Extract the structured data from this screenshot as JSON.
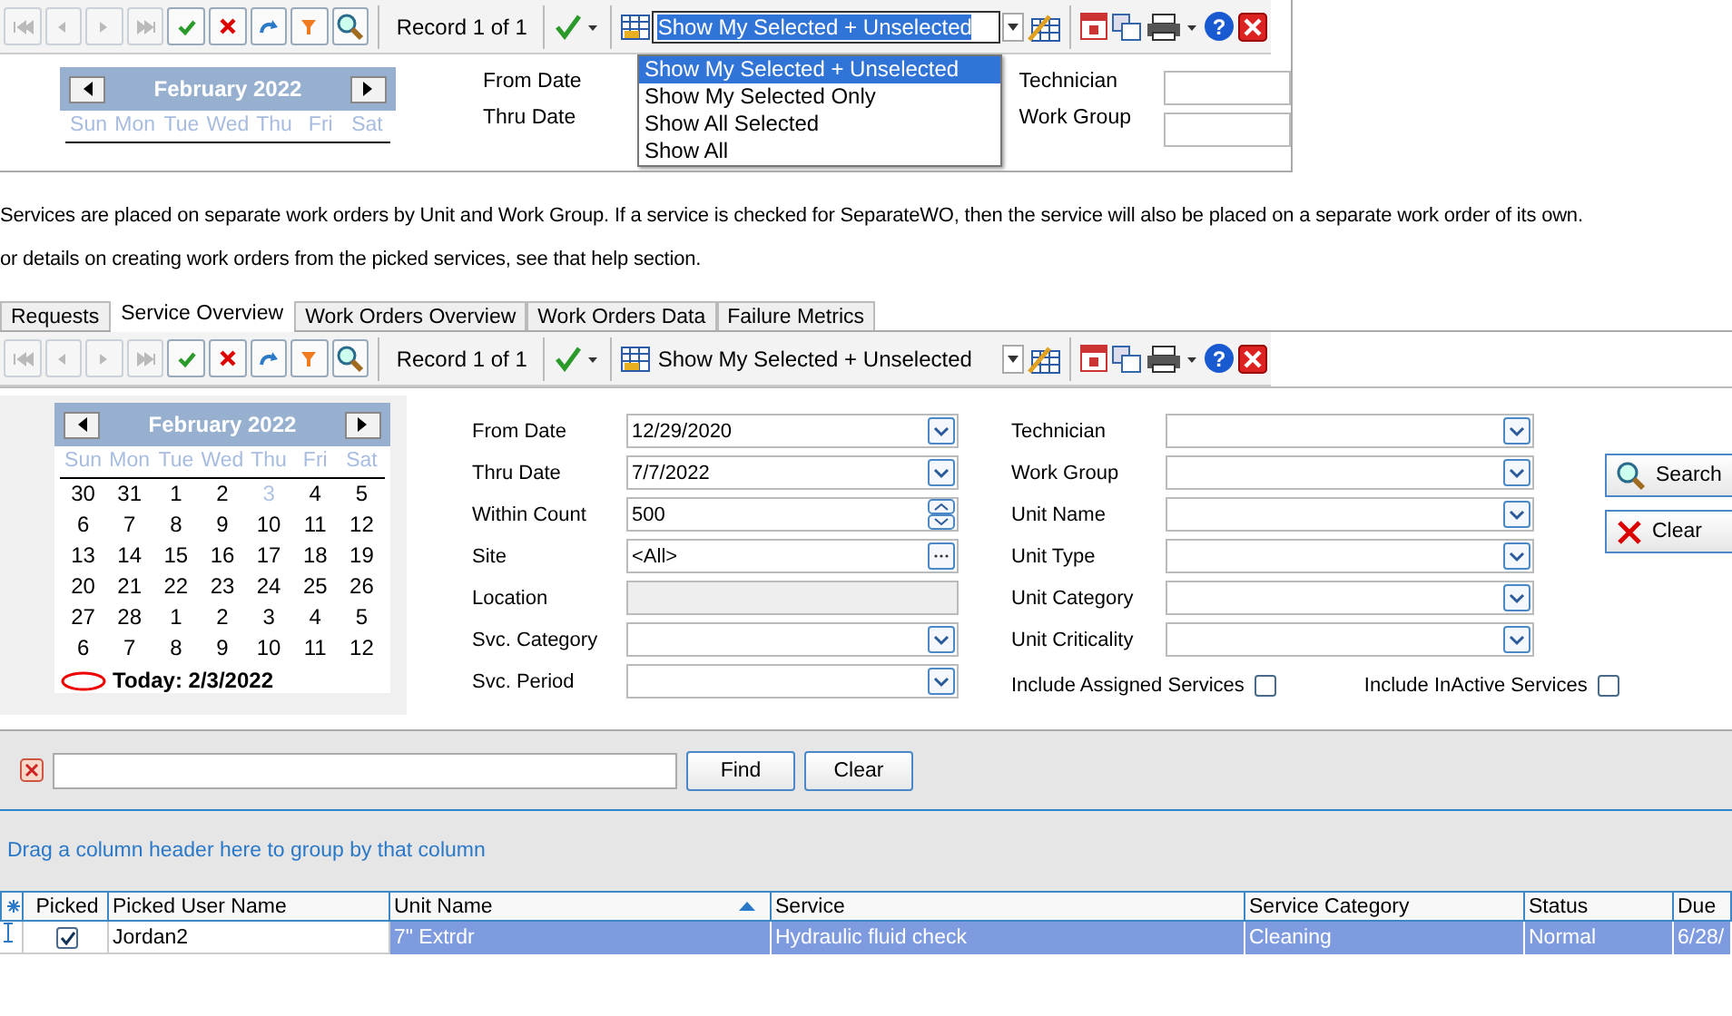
{
  "top_snippet": {
    "toolbar": {
      "nav_disabled": true,
      "record": "Record 1 of 1",
      "view_filter": "Show My Selected + Unselected",
      "view_filter_focused": true,
      "help_glyph": "?"
    },
    "dropdown_options": [
      {
        "label": "Show My Selected + Unselected",
        "selected": true
      },
      {
        "label": "Show My Selected Only",
        "selected": false
      },
      {
        "label": "Show All Selected",
        "selected": false
      },
      {
        "label": "Show All",
        "selected": false
      }
    ],
    "calendar": {
      "month": "February 2022",
      "weekdays": [
        "Sun",
        "Mon",
        "Tue",
        "Wed",
        "Thu",
        "Fri",
        "Sat"
      ]
    },
    "left_labels": [
      "From Date",
      "Thru Date"
    ],
    "right_labels": [
      "Technician",
      "Work Group"
    ]
  },
  "paragraphs": [
    "Services are placed on separate work orders by Unit and Work Group.  If a service is checked for SeparateWO, then the service will also be placed on a separate work order of its own.",
    "or details on creating work orders from the picked services, see that help section."
  ],
  "tabs": [
    {
      "label": "Requests",
      "selected": false
    },
    {
      "label": "Service Overview",
      "selected": true
    },
    {
      "label": "Work Orders Overview",
      "selected": false
    },
    {
      "label": "Work Orders Data",
      "selected": false
    },
    {
      "label": "Failure Metrics",
      "selected": false
    }
  ],
  "toolbar": {
    "nav_disabled": true,
    "record": "Record 1 of 1",
    "view_filter": "Show My Selected + Unselected",
    "view_filter_focused": false,
    "help_glyph": "?"
  },
  "calendar": {
    "month": "February 2022",
    "weekdays": [
      "Sun",
      "Mon",
      "Tue",
      "Wed",
      "Thu",
      "Fri",
      "Sat"
    ],
    "weeks": [
      [
        {
          "day": "30",
          "selected": false
        },
        {
          "day": "31",
          "selected": false
        },
        {
          "day": "1",
          "selected": false
        },
        {
          "day": "2",
          "selected": false
        },
        {
          "day": "3",
          "selected": true
        },
        {
          "day": "4",
          "selected": false
        },
        {
          "day": "5",
          "selected": false
        }
      ],
      [
        {
          "day": "6",
          "selected": false
        },
        {
          "day": "7",
          "selected": false
        },
        {
          "day": "8",
          "selected": false
        },
        {
          "day": "9",
          "selected": false
        },
        {
          "day": "10",
          "selected": false
        },
        {
          "day": "11",
          "selected": false
        },
        {
          "day": "12",
          "selected": false
        }
      ],
      [
        {
          "day": "13",
          "selected": false
        },
        {
          "day": "14",
          "selected": false
        },
        {
          "day": "15",
          "selected": false
        },
        {
          "day": "16",
          "selected": false
        },
        {
          "day": "17",
          "selected": false
        },
        {
          "day": "18",
          "selected": false
        },
        {
          "day": "19",
          "selected": false
        }
      ],
      [
        {
          "day": "20",
          "selected": false
        },
        {
          "day": "21",
          "selected": false
        },
        {
          "day": "22",
          "selected": false
        },
        {
          "day": "23",
          "selected": false
        },
        {
          "day": "24",
          "selected": false
        },
        {
          "day": "25",
          "selected": false
        },
        {
          "day": "26",
          "selected": false
        }
      ],
      [
        {
          "day": "27",
          "selected": false
        },
        {
          "day": "28",
          "selected": false
        },
        {
          "day": "1",
          "selected": false
        },
        {
          "day": "2",
          "selected": false
        },
        {
          "day": "3",
          "selected": false
        },
        {
          "day": "4",
          "selected": false
        },
        {
          "day": "5",
          "selected": false
        }
      ],
      [
        {
          "day": "6",
          "selected": false
        },
        {
          "day": "7",
          "selected": false
        },
        {
          "day": "8",
          "selected": false
        },
        {
          "day": "9",
          "selected": false
        },
        {
          "day": "10",
          "selected": false
        },
        {
          "day": "11",
          "selected": false
        },
        {
          "day": "12",
          "selected": false
        }
      ]
    ],
    "today": "Today: 2/3/2022"
  },
  "left_fields": [
    {
      "label": "From Date",
      "kind": "date",
      "value": "12/29/2020"
    },
    {
      "label": "Thru Date",
      "kind": "date",
      "value": "7/7/2022"
    },
    {
      "label": "Within Count",
      "kind": "spin",
      "value": "500"
    },
    {
      "label": "Site",
      "kind": "lookup",
      "value": "<All>"
    },
    {
      "label": "Location",
      "kind": "disabled"
    },
    {
      "label": "Svc. Category",
      "kind": "combo"
    },
    {
      "label": "Svc. Period",
      "kind": "date"
    }
  ],
  "right_fields": [
    {
      "label": "Technician"
    },
    {
      "label": "Work Group"
    },
    {
      "label": "Unit Name"
    },
    {
      "label": "Unit Type"
    },
    {
      "label": "Unit Category"
    },
    {
      "label": "Unit Criticality"
    }
  ],
  "checkboxes": [
    {
      "label": "Include Assigned Services",
      "checked": false
    },
    {
      "label": "Include InActive Services",
      "checked": false
    }
  ],
  "action_buttons": [
    {
      "label": "Search",
      "kind": "search"
    },
    {
      "label": "Clear",
      "kind": "clear"
    }
  ],
  "find_bar": {
    "find": "Find",
    "clear": "Clear"
  },
  "group_hint": "Drag a column header here to group by that column",
  "grid": {
    "picked_header": "Picked",
    "columns": [
      {
        "label": "Picked User Name",
        "sorted": false
      },
      {
        "label": "Unit Name",
        "sorted": true
      },
      {
        "label": "Service",
        "sorted": false
      },
      {
        "label": "Service Category",
        "sorted": false
      },
      {
        "label": "Status",
        "sorted": false
      },
      {
        "label": "Due",
        "sorted": false
      }
    ],
    "rows": [
      {
        "selected": true,
        "picked": true,
        "cells": [
          "Jordan2",
          "7\" Extrdr",
          "Hydraulic fluid check",
          "Cleaning",
          "Normal",
          "6/28/"
        ]
      }
    ]
  }
}
